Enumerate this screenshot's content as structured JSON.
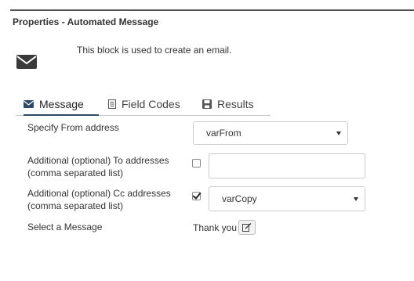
{
  "panel": {
    "title": "Properties - Automated Message",
    "description": "This block is used to create an email.",
    "block_icon": "envelope-icon"
  },
  "tabs": [
    {
      "label": "Message",
      "icon": "envelope-icon",
      "active": true
    },
    {
      "label": "Field Codes",
      "icon": "document-icon",
      "active": false
    },
    {
      "label": "Results",
      "icon": "save-icon",
      "active": false
    }
  ],
  "form": {
    "from": {
      "label": "Specify From address",
      "selected": "varFrom"
    },
    "to": {
      "label_line1": "Additional (optional) To addresses",
      "label_line2": "(comma separated list)",
      "checked": false,
      "value": ""
    },
    "cc": {
      "label_line1": "Additional (optional) Cc addresses",
      "label_line2": "(comma separated list)",
      "checked": true,
      "selected": "varCopy"
    },
    "message": {
      "label": "Select a Message",
      "value": "Thank you",
      "edit_icon": "edit-icon"
    }
  },
  "colors": {
    "tab_active_underline": "#2f4a66",
    "text": "#333333",
    "border": "#cccccc"
  }
}
